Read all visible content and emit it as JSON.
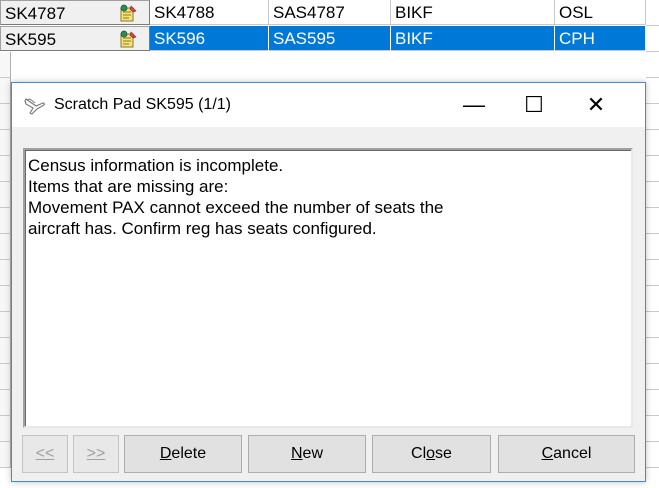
{
  "grid": {
    "rows": [
      {
        "c1": "SK4787",
        "c2": "SK4788",
        "c3": "SAS4787",
        "c4": "BIKF",
        "c5": "OSL"
      },
      {
        "c1": "SK595",
        "c2": "SK596",
        "c3": "SAS595",
        "c4": "BIKF",
        "c5": "CPH"
      },
      {
        "c1": "",
        "c2": "",
        "c3": "",
        "c4": "",
        "c5": ""
      }
    ],
    "selected_row_color": "#0078d7"
  },
  "dialog": {
    "title": "Scratch Pad SK595  (1/1)",
    "title_icon": "airplane-icon",
    "minimize_glyph": "—",
    "maximize_glyph": "☐",
    "close_glyph": "✕",
    "message_lines": [
      "Census information is incomplete.",
      "Items that are missing are:",
      "Movement PAX cannot exceed the number of seats the",
      "aircraft has. Confirm reg has seats configured."
    ],
    "buttons": {
      "first": "<<",
      "next": ">>",
      "delete_hot": "D",
      "delete_rest": "elete",
      "new_hot": "N",
      "new_rest": "ew",
      "close_pre": "Cl",
      "close_hot": "o",
      "close_rest": "se",
      "cancel_hot": "C",
      "cancel_rest": "ancel"
    }
  }
}
